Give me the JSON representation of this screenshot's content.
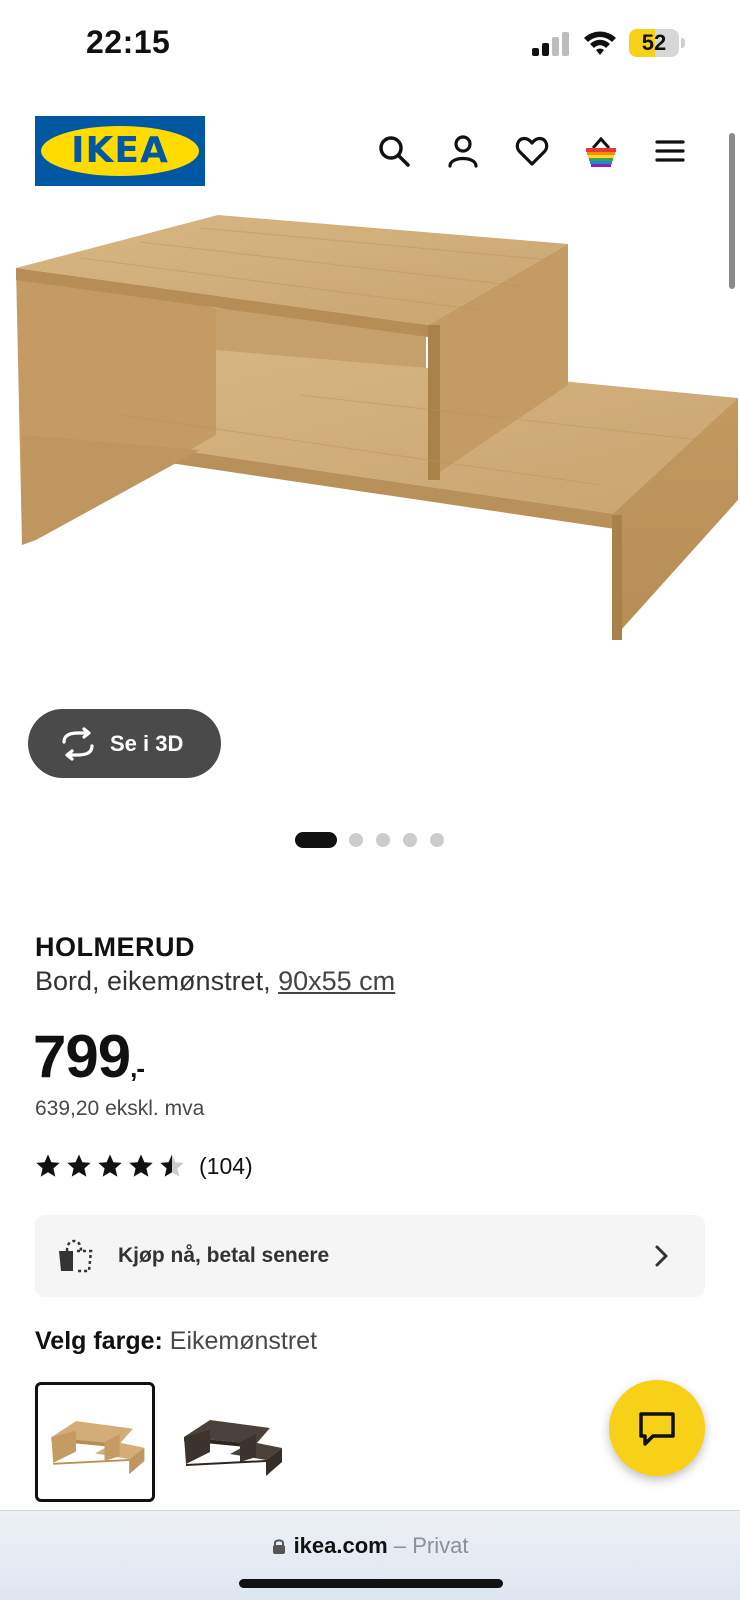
{
  "status_bar": {
    "time": "22:15",
    "battery_level": "52",
    "battery_fraction": 0.52,
    "battery_color": "#f7d117"
  },
  "header": {
    "logo_text": "IKEA",
    "icons": [
      "search-icon",
      "user-icon",
      "heart-icon",
      "basket-icon",
      "menu-icon"
    ]
  },
  "gallery": {
    "view_3d_label": "Se i 3D",
    "total_images": 5,
    "active_index": 0
  },
  "product": {
    "name": "HOLMERUD",
    "description": "Bord, eikemønstret, ",
    "size": "90x55 cm",
    "price": "799",
    "price_suffix": ",-",
    "price_excl_vat": "639,20 ekskl. mva",
    "rating": 4.5,
    "rating_max": 5,
    "rating_count": "(104)"
  },
  "pay_later": {
    "label": "Kjøp nå, betal senere"
  },
  "color_select": {
    "label": "Velg farge:",
    "value": "Eikemønstret",
    "options": [
      {
        "name": "oak-effect",
        "selected": true,
        "color": "#c9a16c"
      },
      {
        "name": "black-brown",
        "selected": false,
        "color": "#3b332c"
      }
    ]
  },
  "colors": {
    "brand_blue": "#0058a3",
    "brand_yellow": "#ffdb00",
    "chat_yellow": "#f7d117"
  },
  "browser": {
    "domain": "ikea.com",
    "mode": " – Privat"
  }
}
